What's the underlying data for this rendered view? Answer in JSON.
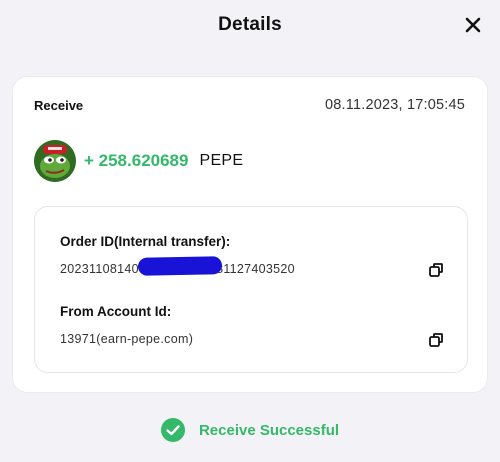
{
  "header": {
    "title": "Details"
  },
  "transaction": {
    "type": "Receive",
    "timestamp": "08.11.2023, 17:05:45",
    "amount": "+ 258.620689",
    "symbol": "PEPE"
  },
  "order": {
    "label": "Order ID(Internal transfer):",
    "value_prefix": "20231108140",
    "value_suffix": "081127403520"
  },
  "from_account": {
    "label": "From Account Id:",
    "value": "13971(earn-pepe.com)"
  },
  "status": {
    "text": "Receive Successful"
  },
  "colors": {
    "accent_green": "#35b86a",
    "redaction": "#1813d6",
    "background": "#f3f2f6"
  },
  "icons": {
    "close": "close-icon",
    "copy": "copy-icon",
    "success": "check-circle-icon",
    "token": "pepe-avatar"
  }
}
